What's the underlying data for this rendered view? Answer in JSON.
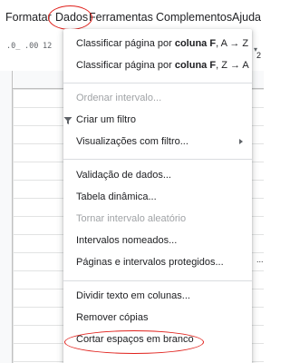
{
  "menubar": {
    "items": [
      "Formatar",
      "Dados",
      "Ferramentas",
      "Complementos",
      "Ajuda"
    ]
  },
  "toolbar": {
    "decrease_decimals": ".0_",
    "increase_decimals": ".00",
    "format_fragment": "12"
  },
  "edge_fragments": [
    "2",
    "..."
  ],
  "menu": {
    "sort_asc_prefix": "Classificar página por ",
    "sort_asc_column": "coluna F",
    "sort_asc_suffix": ", A → Z",
    "sort_desc_prefix": "Classificar página por ",
    "sort_desc_column": "coluna F",
    "sort_desc_suffix": ", Z → A",
    "sort_range": "Ordenar intervalo...",
    "create_filter": "Criar um filtro",
    "filter_views": "Visualizações com filtro...",
    "data_validation": "Validação de dados...",
    "pivot_table": "Tabela dinâmica...",
    "randomize_range": "Tornar intervalo aleatório",
    "named_ranges": "Intervalos nomeados...",
    "protected_ranges": "Páginas e intervalos protegidos...",
    "split_text": "Dividir texto em colunas...",
    "remove_duplicates": "Remover cópias",
    "trim_whitespace": "Cortar espaços em branco"
  },
  "icons": {
    "filter": "filter-icon",
    "submenu": "chevron-right-icon"
  },
  "colors": {
    "highlight_ring": "#e0201b",
    "disabled_text": "#a0a3a6",
    "text": "#202124"
  }
}
